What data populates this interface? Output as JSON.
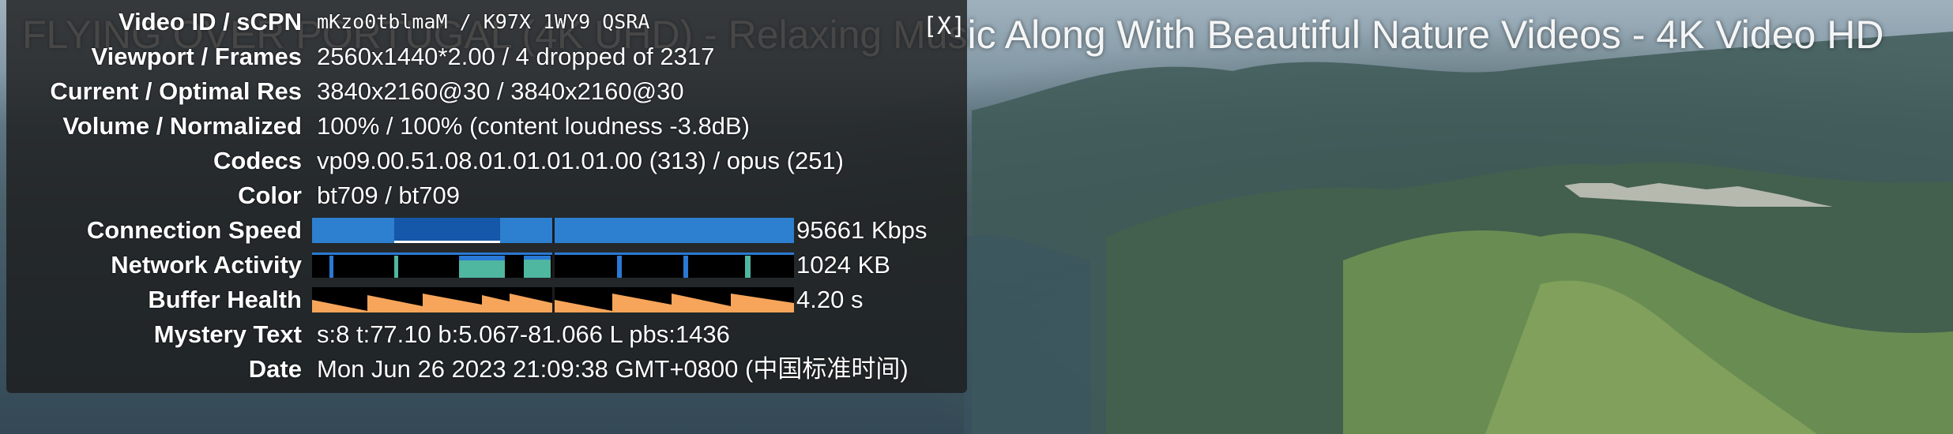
{
  "video": {
    "title": "FLYING OVER PORTUGAL (4K UHD) - Relaxing Music Along With Beautiful Nature Videos - 4K Video HD"
  },
  "stats": {
    "close_label": "[X]",
    "rows": [
      {
        "label": "Video ID / sCPN",
        "value": "mKzo0tblmaM / K97X 1WY9 QSRA"
      },
      {
        "label": "Viewport / Frames",
        "value": "2560x1440*2.00 / 4 dropped of 2317"
      },
      {
        "label": "Current / Optimal Res",
        "value": "3840x2160@30 / 3840x2160@30"
      },
      {
        "label": "Volume / Normalized",
        "value": "100% / 100% (content loudness -3.8dB)"
      },
      {
        "label": "Codecs",
        "value": "vp09.00.51.08.01.01.01.01.00 (313) / opus (251)"
      },
      {
        "label": "Color",
        "value": "bt709 / bt709"
      },
      {
        "label": "Connection Speed",
        "value": "95661 Kbps"
      },
      {
        "label": "Network Activity",
        "value": "1024 KB"
      },
      {
        "label": "Buffer Health",
        "value": "4.20 s"
      },
      {
        "label": "Mystery Text",
        "value": "s:8 t:77.10 b:5.067-81.066 L pbs:1436"
      },
      {
        "label": "Date",
        "value": "Mon Jun 26 2023 21:09:38 GMT+0800 (中国标准时间)"
      }
    ]
  },
  "colors": {
    "connection_bar": "#2d7fd0",
    "connection_dark": "#1557a8",
    "network_bg": "#000000",
    "network_blue": "#2a79d4",
    "network_green": "#4fb6a0",
    "buffer_fill": "#f7a55a"
  }
}
